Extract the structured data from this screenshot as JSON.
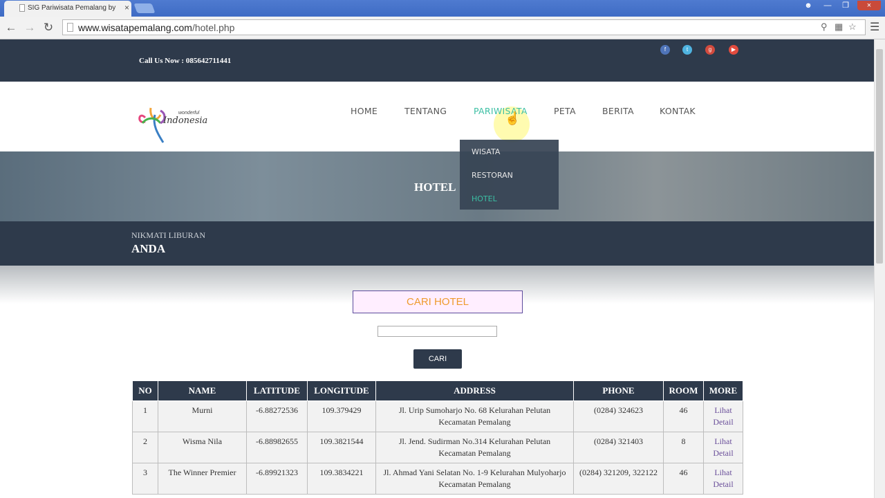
{
  "browser": {
    "tab_title": "SIG Pariwisata Pemalang by",
    "url_host": "www.wisatapemalang.com",
    "url_path": "/hotel.php"
  },
  "topbar": {
    "callus": "Call Us Now : 085642711441",
    "social_icons": [
      "facebook-icon",
      "twitter-icon",
      "google-plus-icon",
      "youtube-icon"
    ],
    "social_colors": [
      "#4f74b8",
      "#4fb3e0",
      "#d24b3e",
      "#e24b3e"
    ]
  },
  "logo": {
    "line1": "wonderful",
    "line2": "Indonesia"
  },
  "nav": [
    "HOME",
    "TENTANG",
    "PARIWISATA",
    "PETA",
    "BERITA",
    "KONTAK"
  ],
  "nav_active": "PARIWISATA",
  "dropdown": [
    "WISATA",
    "RESTORAN",
    "HOTEL"
  ],
  "dropdown_active": "HOTEL",
  "banner": {
    "title": "HOTEL"
  },
  "tagline": {
    "line1": "NIKMATI LIBURAN",
    "line2": "ANDA"
  },
  "search": {
    "title": "CARI HOTEL",
    "value": "",
    "button": "CARI"
  },
  "table": {
    "headers": [
      "NO",
      "NAME",
      "LATITUDE",
      "LONGITUDE",
      "ADDRESS",
      "PHONE",
      "ROOM",
      "MORE"
    ],
    "rows": [
      {
        "no": "1",
        "name": "Murni",
        "lat": "-6.88272536",
        "lng": "109.379429",
        "address": "Jl. Urip Sumoharjo No. 68 Kelurahan Pelutan Kecamatan Pemalang",
        "phone": "(0284) 324623",
        "room": "46",
        "more": "Lihat Detail"
      },
      {
        "no": "2",
        "name": "Wisma Nila",
        "lat": "-6.88982655",
        "lng": "109.3821544",
        "address": "Jl. Jend. Sudirman No.314 Kelurahan Pelutan Kecamatan Pemalang",
        "phone": "(0284) 321403",
        "room": "8",
        "more": "Lihat Detail"
      },
      {
        "no": "3",
        "name": "The Winner Premier",
        "lat": "-6.89921323",
        "lng": "109.3834221",
        "address": "Jl. Ahmad Yani Selatan No. 1-9 Kelurahan Mulyoharjo Kecamatan Pemalang",
        "phone": "(0284) 321209, 322122",
        "room": "46",
        "more": "Lihat Detail"
      }
    ]
  },
  "colors": {
    "dark": "#2e3a4b",
    "accent": "#3bbfa3",
    "search_title": "#ef9b2e"
  }
}
